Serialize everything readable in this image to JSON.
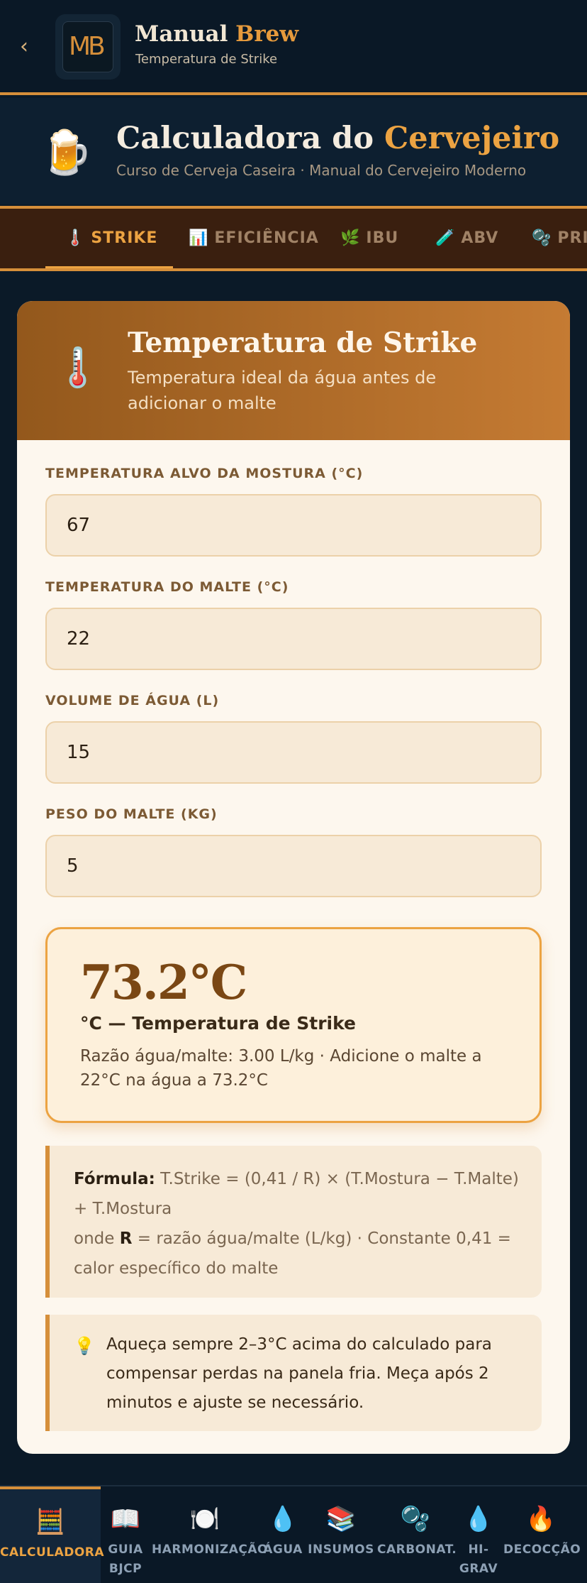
{
  "appbar": {
    "back": "‹",
    "logo": "MB",
    "brand_main": "Manual",
    "brand_accent": "Brew",
    "subtitle": "Temperatura de Strike"
  },
  "hero": {
    "icon": "🍺",
    "title_main": "Calculadora do",
    "title_accent": "Cervejeiro",
    "subtitle": "Curso de Cerveja Caseira · Manual do Cervejeiro Moderno"
  },
  "tabs": [
    {
      "icon": "🌡️",
      "label": "STRIKE"
    },
    {
      "icon": "📊",
      "label": "EFICIÊNCIA"
    },
    {
      "icon": "🌿",
      "label": "IBU"
    },
    {
      "icon": "🧪",
      "label": "ABV"
    },
    {
      "icon": "🫧",
      "label": "PRIMING"
    }
  ],
  "card": {
    "icon": "🌡️",
    "title": "Temperatura de Strike",
    "subtitle": "Temperatura ideal da água antes de adicionar o malte"
  },
  "fields": [
    {
      "label": "TEMPERATURA ALVO DA MOSTURA (°C)",
      "value": "67"
    },
    {
      "label": "TEMPERATURA DO MALTE (°C)",
      "value": "22"
    },
    {
      "label": "VOLUME DE ÁGUA (L)",
      "value": "15"
    },
    {
      "label": "PESO DO MALTE (KG)",
      "value": "5"
    }
  ],
  "result": {
    "value": "73.2°C",
    "unit": "°C — Temperatura de Strike",
    "desc": "Razão água/malte: 3.00 L/kg · Adicione o malte a 22°C na água a 73.2°C"
  },
  "formula": {
    "label": "Fórmula:",
    "expr": " T.Strike = (0,41 / R) × (T.Mostura − T.Malte) + T.Mostura",
    "where_pre": "onde ",
    "where_r": "R",
    "where_post": " = razão água/malte (L/kg) · Constante 0,41 = calor específico do malte"
  },
  "tip": {
    "icon": "💡",
    "text": "Aqueça sempre 2–3°C acima do calculado para compensar perdas na panela fria. Meça após 2 minutos e ajuste se necessário."
  },
  "bottom_nav": [
    {
      "icon": "🧮",
      "label": "CALCULADORA"
    },
    {
      "icon": "📖",
      "label": "GUIA BJCP"
    },
    {
      "icon": "🍽️",
      "label": "HARMONIZAÇÃO"
    },
    {
      "icon": "💧",
      "label": "ÁGUA"
    },
    {
      "icon": "📚",
      "label": "INSUMOS"
    },
    {
      "icon": "🫧",
      "label": "CARBONAT."
    },
    {
      "icon": "💧",
      "label": "HI-GRAV"
    },
    {
      "icon": "🔥",
      "label": "DECOCÇÃO"
    }
  ],
  "colors": {
    "accent": "#eca342",
    "background": "#0b1a28",
    "card": "#fdf7ee"
  }
}
